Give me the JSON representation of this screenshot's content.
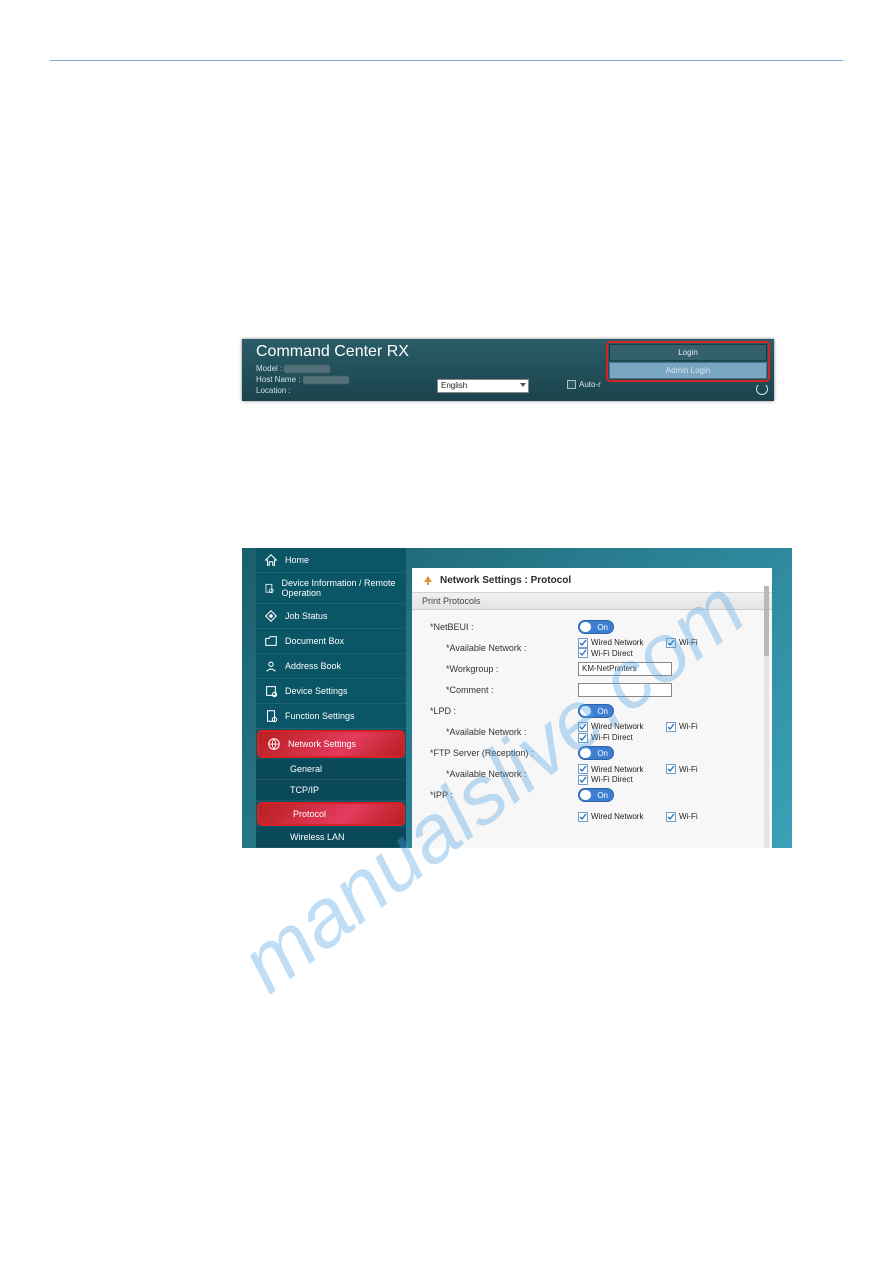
{
  "watermark_text": "manualslive.com",
  "fig1": {
    "title": "Command Center RX",
    "model_label": "Model :",
    "hostname_label": "Host Name :",
    "location_label": "Location :",
    "language": "English",
    "auto_refresh": "Auto-r",
    "login": "Login",
    "admin_login": "Admin Login"
  },
  "fig2": {
    "nav": {
      "home": "Home",
      "device_info": "Device Information / Remote Operation",
      "job_status": "Job Status",
      "document_box": "Document Box",
      "address_book": "Address Book",
      "device_settings": "Device Settings",
      "function_settings": "Function Settings",
      "network_settings": "Network Settings",
      "general": "General",
      "tcpip": "TCP/IP",
      "protocol": "Protocol",
      "wireless_lan": "Wireless LAN"
    },
    "crumb": "Network Settings : Protocol",
    "section": "Print Protocols",
    "labels": {
      "netbeui": "*NetBEUI :",
      "available_network": "*Available Network :",
      "workgroup": "*Workgroup :",
      "comment": "*Comment :",
      "lpd": "*LPD :",
      "ftp": "*FTP Server (Reception) :",
      "ipp": "*IPP :",
      "wired": "Wired Network",
      "wifi": "Wi-Fi",
      "wifidirect": "Wi-Fi Direct",
      "on": "On"
    },
    "workgroup_value": "KM-NetPrinters"
  }
}
